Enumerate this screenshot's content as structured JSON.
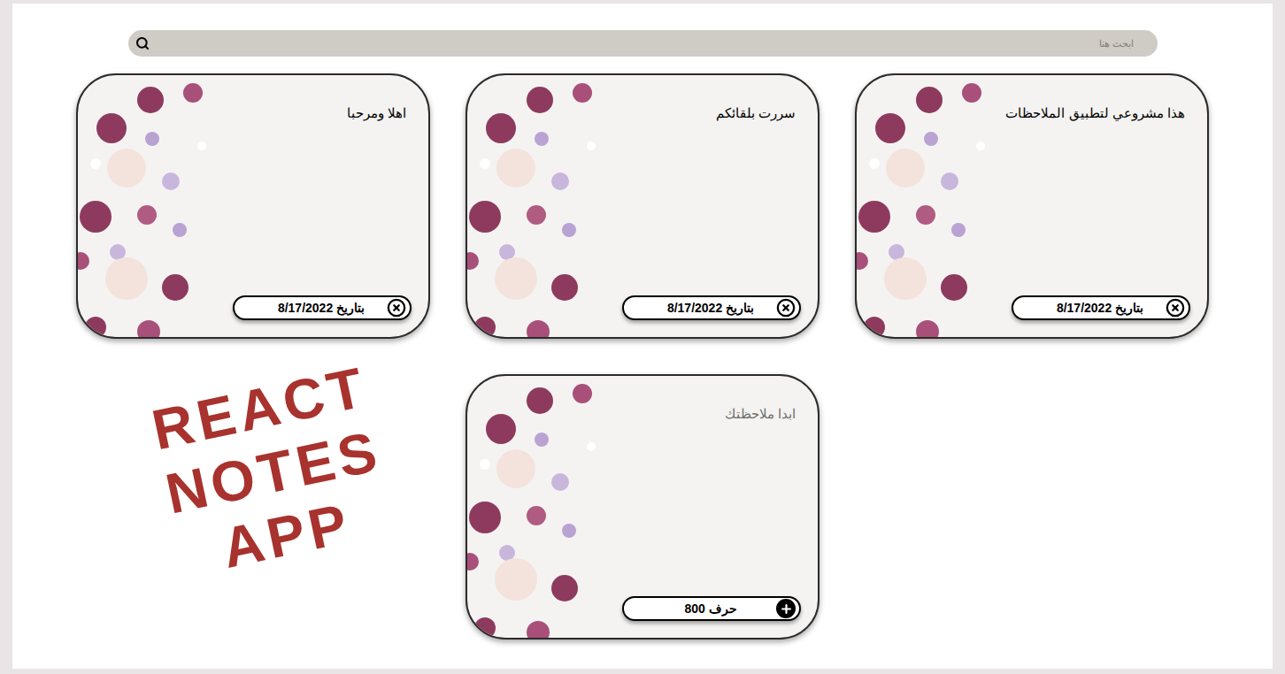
{
  "search": {
    "placeholder": "ابحث هنا"
  },
  "notes": [
    {
      "text": "هذا مشروعي لتطبيق الملاحظات",
      "date": "بتاريخ 8/17/2022"
    },
    {
      "text": "سررت بلقائكم",
      "date": "بتاريخ 8/17/2022"
    },
    {
      "text": "اهلا ومرحبا",
      "date": "بتاريخ 8/17/2022"
    }
  ],
  "new_note": {
    "placeholder": "ابدا ملاحظتك",
    "counter": "حرف 800"
  },
  "banner": {
    "lines": [
      "REACT",
      "NOTES",
      "APP"
    ]
  }
}
